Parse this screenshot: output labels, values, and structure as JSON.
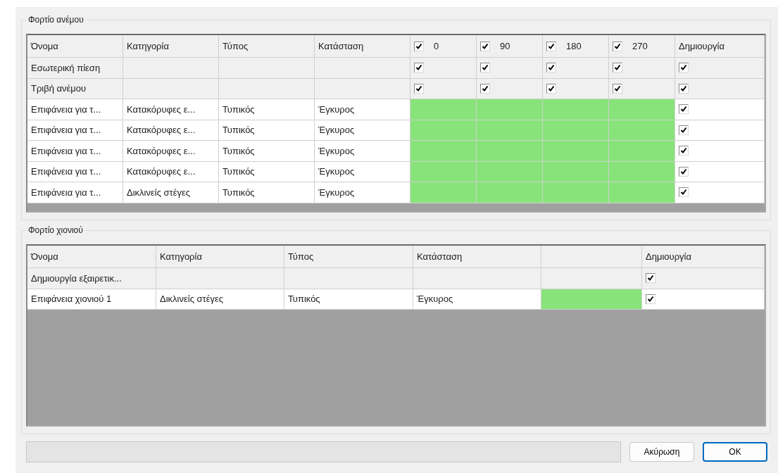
{
  "wind_load": {
    "title": "Φορτίο ανέμου",
    "columns": [
      "Όνομα",
      "Κατηγορία",
      "Τύπος",
      "Κατάσταση"
    ],
    "directions": [
      {
        "label": "0",
        "checked": true
      },
      {
        "label": "90",
        "checked": true
      },
      {
        "label": "180",
        "checked": true
      },
      {
        "label": "270",
        "checked": true
      }
    ],
    "create_column": "Δημιουργία",
    "rows": [
      {
        "kind": "group",
        "name": "Εσωτερική πίεση",
        "directions": [
          true,
          true,
          true,
          true
        ],
        "create": true
      },
      {
        "kind": "group",
        "name": "Τριβή ανέμου",
        "directions": [
          true,
          true,
          true,
          true
        ],
        "create": true
      },
      {
        "kind": "surface",
        "name": "Επιφάνεια για τ...",
        "category": "Κατακόρυφες ε...",
        "type": "Τυπικός",
        "status": "Έγκυρος",
        "color": "#88e47a",
        "create": true
      },
      {
        "kind": "surface",
        "name": "Επιφάνεια για τ...",
        "category": "Κατακόρυφες ε...",
        "type": "Τυπικός",
        "status": "Έγκυρος",
        "color": "#88e47a",
        "create": true
      },
      {
        "kind": "surface",
        "name": "Επιφάνεια για τ...",
        "category": "Κατακόρυφες ε...",
        "type": "Τυπικός",
        "status": "Έγκυρος",
        "color": "#88e47a",
        "create": true
      },
      {
        "kind": "surface",
        "name": "Επιφάνεια για τ...",
        "category": "Κατακόρυφες ε...",
        "type": "Τυπικός",
        "status": "Έγκυρος",
        "color": "#88e47a",
        "create": true
      },
      {
        "kind": "surface",
        "name": "Επιφάνεια για τ...",
        "category": "Δικλινείς στέγες",
        "type": "Τυπικός",
        "status": "Έγκυρος",
        "color": "#88e47a",
        "create": true
      }
    ]
  },
  "snow_load": {
    "title": "Φορτίο χιονιού",
    "columns": [
      "Όνομα",
      "Κατηγορία",
      "Τύπος",
      "Κατάσταση"
    ],
    "create_column": "Δημιουργία",
    "rows": [
      {
        "kind": "group",
        "name": "Δημιουργία εξαιρετικ...",
        "create": true
      },
      {
        "kind": "surface",
        "name": "Επιφάνεια χιονιού 1",
        "category": "Δικλινείς στέγες",
        "type": "Τυπικός",
        "status": "Έγκυρος",
        "color": "#88e47a",
        "create": true
      }
    ]
  },
  "buttons": [
    {
      "label": "Ακύρωση",
      "default": false
    },
    {
      "label": "OK",
      "default": true
    }
  ]
}
